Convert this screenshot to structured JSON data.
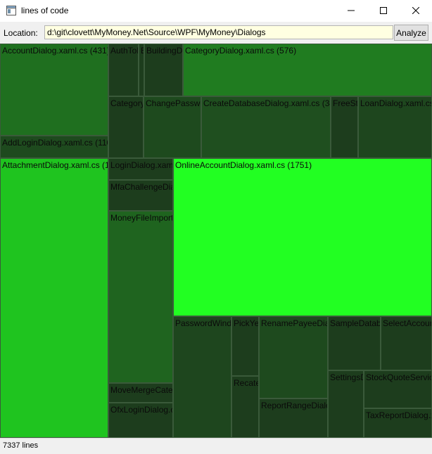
{
  "window": {
    "title": "lines of code"
  },
  "toolbar": {
    "location_label": "Location:",
    "location_value": "d:\\git\\clovett\\MyMoney.Net\\Source\\WPF\\MyMoney\\Dialogs",
    "analyze_label": "Analyze"
  },
  "icons": {
    "app": "app-window-icon",
    "minimize": "minimize-icon",
    "maximize": "maximize-icon",
    "close": "close-icon"
  },
  "treemap": {
    "cells": [
      {
        "label": "AccountDialog.xaml.cs (431)",
        "color": "#1f6f1f"
      },
      {
        "label": "AddLoginDialog.xaml.cs (110)",
        "color": "#1e4a1e"
      },
      {
        "label": "AttachmentDialog.xaml.cs (1",
        "color": "#1fc41f"
      },
      {
        "label": "AuthTol",
        "color": "#1d3d1d"
      },
      {
        "label": "B",
        "color": "#1d3d1d"
      },
      {
        "label": "BuildingD",
        "color": "#1d3d1d"
      },
      {
        "label": "CategoryDialog.xaml.cs (576)",
        "color": "#207c20"
      },
      {
        "label": "Category",
        "color": "#1d3d1d"
      },
      {
        "label": "ChangePasswo",
        "color": "#1e4a1e"
      },
      {
        "label": "CreateDatabaseDialog.xaml.cs (34",
        "color": "#1f4f1f"
      },
      {
        "label": "FreeSt",
        "color": "#1d3d1d"
      },
      {
        "label": "LoanDialog.xaml.cs",
        "color": "#1e461e"
      },
      {
        "label": "LoginDialog.xam",
        "color": "#1d3d1d"
      },
      {
        "label": "MfaChallengeDia",
        "color": "#1d3d1d"
      },
      {
        "label": "MoneyFileImport",
        "color": "#1f641f"
      },
      {
        "label": "MoveMergeCate",
        "color": "#1d3d1d"
      },
      {
        "label": "OfxLoginDialog.c",
        "color": "#1d3d1d"
      },
      {
        "label": "OnlineAccountDialog.xaml.cs (1751)",
        "color": "#22ff22"
      },
      {
        "label": "PasswordWind",
        "color": "#1e461e"
      },
      {
        "label": "PickYe",
        "color": "#1d3d1d"
      },
      {
        "label": "Recate",
        "color": "#1d3d1d"
      },
      {
        "label": "RenamePayeeDial",
        "color": "#1e4a1e"
      },
      {
        "label": "ReportRangeDialo",
        "color": "#1d3d1d"
      },
      {
        "label": "SampleDatab",
        "color": "#1d3d1d"
      },
      {
        "label": "SelectAccoun",
        "color": "#1d3d1d"
      },
      {
        "label": "SettingsD",
        "color": "#1d3d1d"
      },
      {
        "label": "StockQuoteServic",
        "color": "#1d3d1d"
      },
      {
        "label": "TaxReportDialog.x",
        "color": "#1d3d1d"
      }
    ]
  },
  "status": {
    "text": "7337 lines"
  }
}
